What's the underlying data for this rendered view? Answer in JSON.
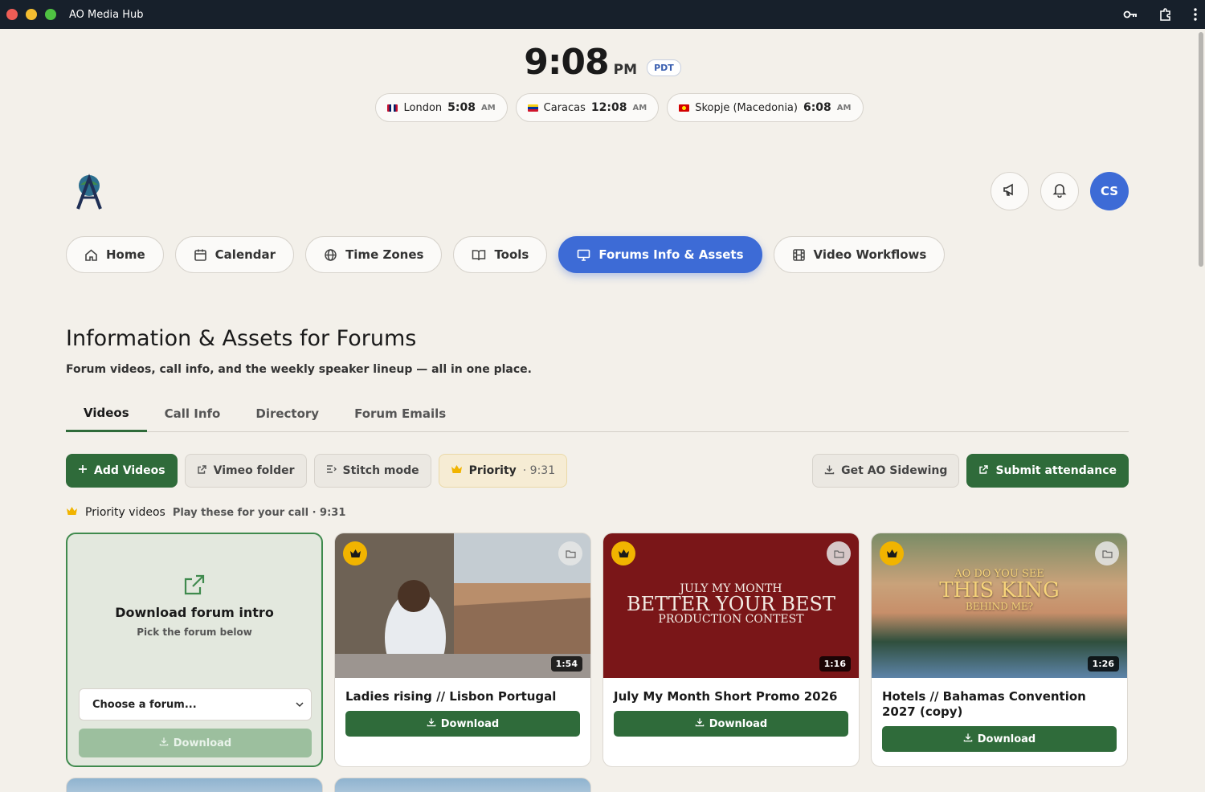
{
  "window": {
    "title": "AO Media Hub"
  },
  "clock": {
    "time": "9:08",
    "ampm": "PM",
    "tz": "PDT"
  },
  "zones": [
    {
      "city": "London",
      "time": "5:08",
      "ampm": "AM",
      "flag": "uk"
    },
    {
      "city": "Caracas",
      "time": "12:08",
      "ampm": "AM",
      "flag": "ve"
    },
    {
      "city": "Skopje (Macedonia)",
      "time": "6:08",
      "ampm": "AM",
      "flag": "mk"
    }
  ],
  "header": {
    "avatar_initials": "CS",
    "icons": [
      "megaphone-icon",
      "bell-icon"
    ]
  },
  "nav": [
    {
      "label": "Home",
      "icon": "home-icon"
    },
    {
      "label": "Calendar",
      "icon": "calendar-icon"
    },
    {
      "label": "Time Zones",
      "icon": "globe-icon"
    },
    {
      "label": "Tools",
      "icon": "book-icon"
    },
    {
      "label": "Forums Info & Assets",
      "icon": "monitor-icon",
      "active": true
    },
    {
      "label": "Video Workflows",
      "icon": "film-icon"
    }
  ],
  "page": {
    "title": "Information & Assets for Forums",
    "subtitle": "Forum videos, call info, and the weekly speaker lineup — all in one place."
  },
  "tabs": [
    {
      "label": "Videos",
      "active": true
    },
    {
      "label": "Call Info"
    },
    {
      "label": "Directory"
    },
    {
      "label": "Forum Emails"
    }
  ],
  "toolbar": {
    "add_videos": "Add Videos",
    "vimeo_folder": "Vimeo folder",
    "stitch_mode": "Stitch mode",
    "priority": "Priority",
    "priority_time": "· 9:31",
    "get_sidewing": "Get AO Sidewing",
    "submit_attendance": "Submit attendance"
  },
  "priority_section": {
    "label": "Priority videos",
    "sub": "Play these for your call · 9:31"
  },
  "intro_card": {
    "title": "Download forum intro",
    "sub": "Pick the forum below",
    "select_value": "Choose a forum...",
    "download": "Download"
  },
  "videos": [
    {
      "title": "Ladies rising // Lisbon Portugal",
      "duration": "1:54",
      "download": "Download"
    },
    {
      "title": "July My Month Short Promo 2026",
      "duration": "1:16",
      "download": "Download",
      "thumb_text": [
        "JULY MY MONTH",
        "BETTER YOUR BEST",
        "PRODUCTION CONTEST"
      ]
    },
    {
      "title": "Hotels // Bahamas Convention 2027 (copy)",
      "duration": "1:26",
      "download": "Download",
      "thumb_text": [
        "AO DO YOU SEE",
        "THIS KING",
        "BEHIND ME?"
      ]
    }
  ],
  "colors": {
    "accent_blue": "#3d6bd6",
    "accent_green": "#2f6b3a",
    "crown": "#f1b400",
    "background": "#f3f0ea"
  }
}
